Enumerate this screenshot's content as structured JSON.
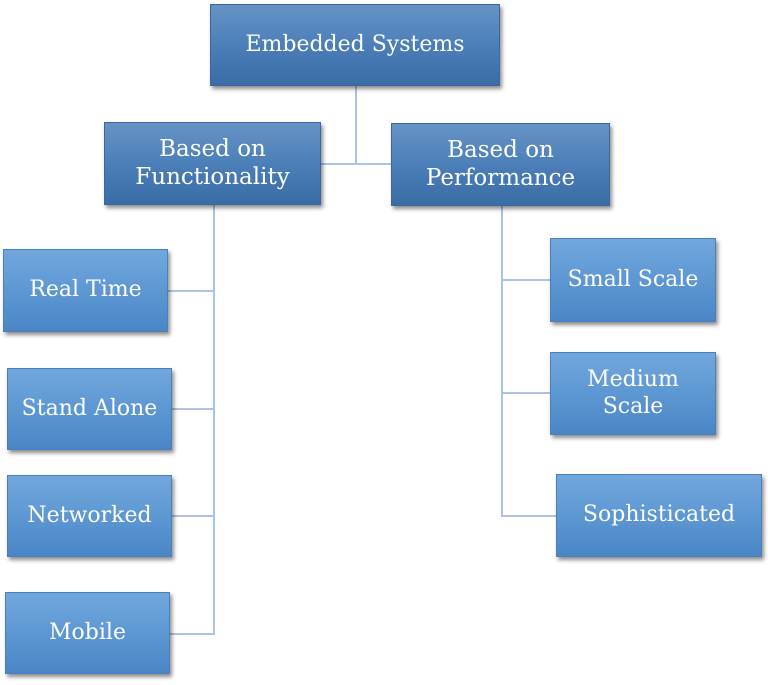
{
  "diagram": {
    "type": "hierarchy",
    "root": {
      "label": "Embedded Systems",
      "children": [
        {
          "label": "Based on\nFunctionality",
          "children": [
            {
              "label": "Real Time"
            },
            {
              "label": "Stand Alone"
            },
            {
              "label": "Networked"
            },
            {
              "label": "Mobile"
            }
          ]
        },
        {
          "label": "Based on\nPerformance",
          "children": [
            {
              "label": "Small Scale"
            },
            {
              "label": "Medium\nScale"
            },
            {
              "label": "Sophisticated"
            }
          ]
        }
      ]
    }
  },
  "colors": {
    "top_box": "#4a7db7",
    "leaf_box": "#5b96d2",
    "connector": "#a9c4e6",
    "text": "#ffffff"
  }
}
